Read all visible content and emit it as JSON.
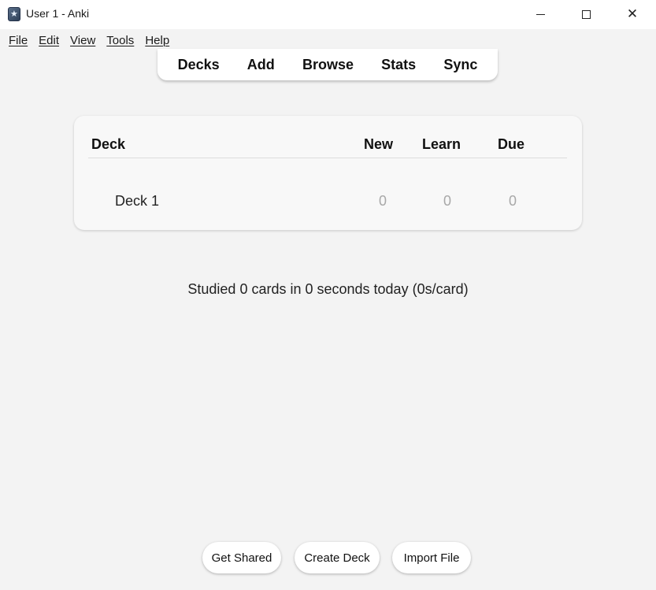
{
  "window": {
    "title": "User 1 - Anki",
    "minimize_icon": "minimize-icon",
    "maximize_icon": "maximize-icon",
    "close_icon": "close-icon",
    "close_glyph": "✕"
  },
  "menu": [
    "File",
    "Edit",
    "View",
    "Tools",
    "Help"
  ],
  "toolbar": [
    "Decks",
    "Add",
    "Browse",
    "Stats",
    "Sync"
  ],
  "deck_table": {
    "headers": {
      "deck": "Deck",
      "new": "New",
      "learn": "Learn",
      "due": "Due"
    },
    "rows": [
      {
        "name": "Deck 1",
        "new": "0",
        "learn": "0",
        "due": "0"
      }
    ]
  },
  "studied_text": "Studied 0 cards in 0 seconds today (0s/card)",
  "bottom_buttons": {
    "get_shared": "Get Shared",
    "create_deck": "Create Deck",
    "import_file": "Import File"
  },
  "colors": {
    "background": "#f3f3f3",
    "card": "#f8f8f8",
    "muted_count": "#a8a8a8"
  }
}
